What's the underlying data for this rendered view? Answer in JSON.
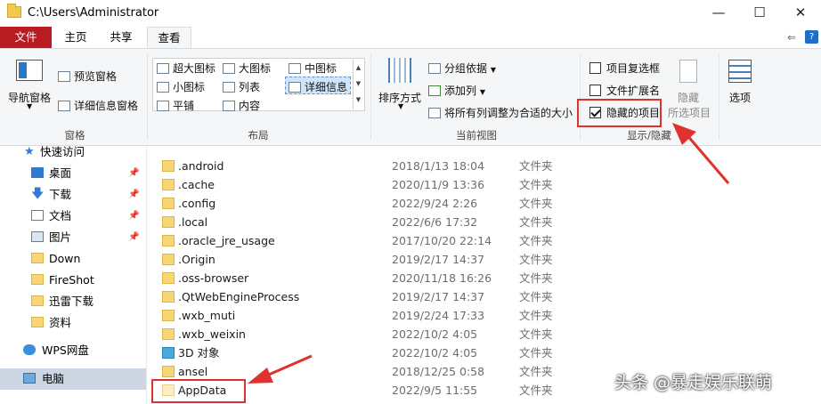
{
  "window": {
    "title": "C:\\Users\\Administrator",
    "minimize": "—",
    "maximize": "☐",
    "close": "✕"
  },
  "tabs": {
    "file": "文件",
    "home": "主页",
    "share": "共享",
    "view": "查看",
    "help": "?"
  },
  "ribbon": {
    "panes": {
      "nav_pane": "导航窗格",
      "preview_pane": "预览窗格",
      "details_pane": "详细信息窗格",
      "group_label": "窗格"
    },
    "layout": {
      "extra_large": "超大图标",
      "large": "大图标",
      "medium": "中图标",
      "small": "小图标",
      "list": "列表",
      "details": "详细信息",
      "tiles": "平铺",
      "content": "内容",
      "group_label": "布局"
    },
    "current_view": {
      "sort_by": "排序方式",
      "group_by": "分组依据",
      "add_columns": "添加列",
      "fit_columns": "将所有列调整为合适的大小",
      "group_label": "当前视图"
    },
    "show_hide": {
      "item_checkboxes": "项目复选框",
      "file_extensions": "文件扩展名",
      "hidden_items": "隐藏的项目",
      "hide_selected": "隐藏",
      "hide_selected_sub": "所选项目",
      "options": "选项",
      "group_label": "显示/隐藏",
      "item_checkboxes_checked": false,
      "file_extensions_checked": false,
      "hidden_items_checked": true
    }
  },
  "nav": {
    "quick_access": "快速访问",
    "items": [
      {
        "label": "桌面"
      },
      {
        "label": "下载"
      },
      {
        "label": "文档"
      },
      {
        "label": "图片"
      },
      {
        "label": "Down"
      },
      {
        "label": "FireShot"
      },
      {
        "label": "迅雷下载"
      },
      {
        "label": "资料"
      },
      {
        "label": "WPS网盘"
      },
      {
        "label": "电脑"
      }
    ]
  },
  "files": [
    {
      "name": ".android",
      "date": "2018/1/13 18:04",
      "type": "文件夹"
    },
    {
      "name": ".cache",
      "date": "2020/11/9 13:36",
      "type": "文件夹"
    },
    {
      "name": ".config",
      "date": "2022/9/24 2:26",
      "type": "文件夹"
    },
    {
      "name": ".local",
      "date": "2022/6/6 17:32",
      "type": "文件夹"
    },
    {
      "name": ".oracle_jre_usage",
      "date": "2017/10/20 22:14",
      "type": "文件夹"
    },
    {
      "name": ".Origin",
      "date": "2019/2/17 14:37",
      "type": "文件夹"
    },
    {
      "name": ".oss-browser",
      "date": "2020/11/18 16:26",
      "type": "文件夹"
    },
    {
      "name": ".QtWebEngineProcess",
      "date": "2019/2/17 14:37",
      "type": "文件夹"
    },
    {
      "name": ".wxb_muti",
      "date": "2019/2/24 17:33",
      "type": "文件夹"
    },
    {
      "name": ".wxb_weixin",
      "date": "2022/10/2 4:05",
      "type": "文件夹"
    },
    {
      "name": "3D 对象",
      "date": "2022/10/2 4:05",
      "type": "文件夹"
    },
    {
      "name": "ansel",
      "date": "2018/12/25 0:58",
      "type": "文件夹"
    },
    {
      "name": "AppData",
      "date": "2022/9/5 11:55",
      "type": "文件夹"
    }
  ],
  "watermark": "头条 @暴走娱乐联萌",
  "colors": {
    "file_tab": "#b81c22",
    "highlight": "#e0322d",
    "selected_nav": "#ccd7e3"
  }
}
